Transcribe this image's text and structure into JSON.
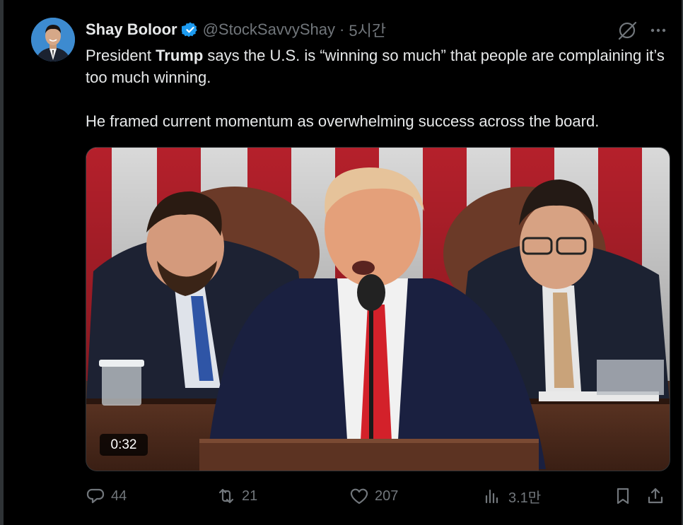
{
  "author": {
    "name": "Shay Boloor",
    "handle": "@StockSavvyShay",
    "separator": "·",
    "time": "5시간"
  },
  "tweet": {
    "para1_prefix": "President ",
    "para1_bold": "Trump",
    "para1_suffix": " says the U.S. is “winning so much” that people are complaining it’s too much winning.",
    "para2": "He framed current momentum as overwhelming success across the board."
  },
  "video": {
    "duration": "0:32"
  },
  "actions": {
    "replies": "44",
    "reposts": "21",
    "likes": "207",
    "views": "3.1만"
  },
  "colors": {
    "background": "#000000",
    "text": "#e7e9ea",
    "muted": "#71767b",
    "verified": "#1d9bf0"
  }
}
